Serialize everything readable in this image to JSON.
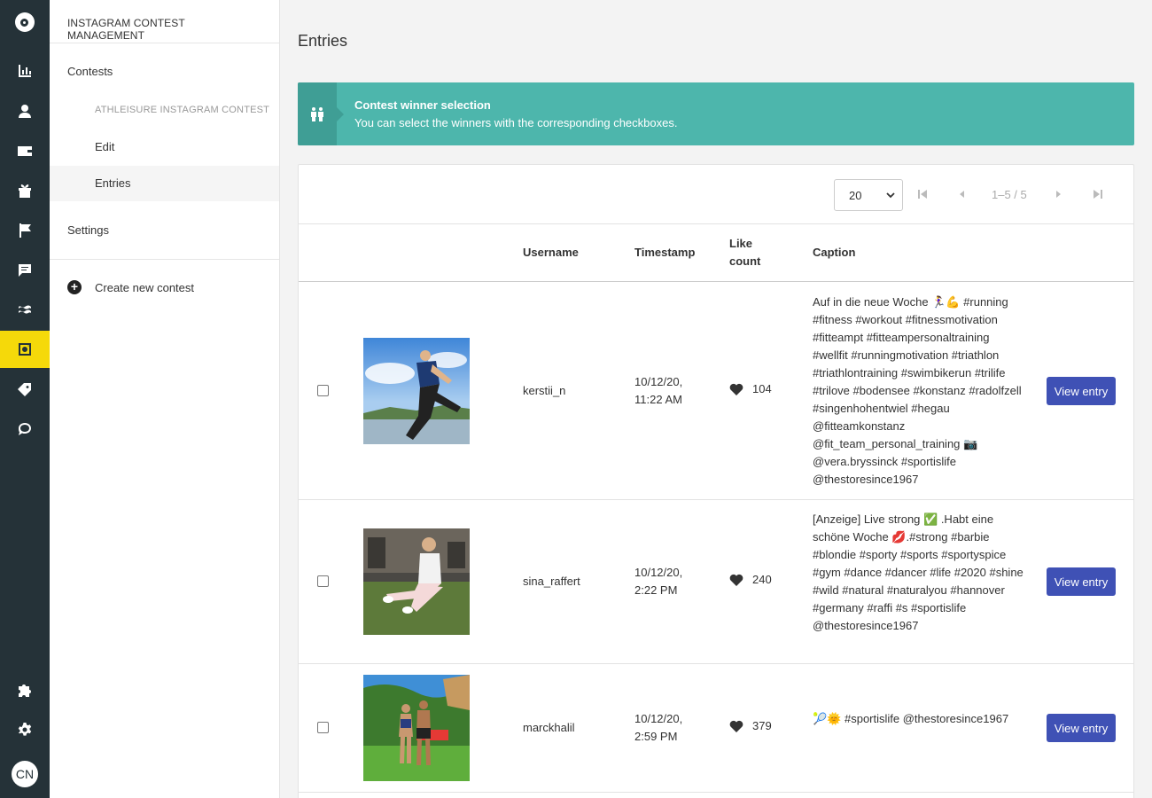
{
  "app": {
    "avatar_initials": "CN"
  },
  "subnav": {
    "header": "INSTAGRAM CONTEST MANAGEMENT",
    "contests": "Contests",
    "contest_name": "ATHLEISURE INSTAGRAM CONTEST",
    "edit": "Edit",
    "entries": "Entries",
    "settings": "Settings",
    "create": "Create new contest"
  },
  "main": {
    "title": "Entries",
    "alert": {
      "title": "Contest winner selection",
      "text": "You can select the winners with the corresponding checkboxes."
    },
    "pager": {
      "page_size": "20",
      "range": "1–5 / 5"
    },
    "columns": {
      "username": "Username",
      "timestamp": "Timestamp",
      "like_count_1": "Like",
      "like_count_2": "count",
      "caption": "Caption"
    },
    "view_label": "View entry",
    "rows": [
      {
        "username": "kerstii_n",
        "date": "10/12/20,",
        "time": "11:22 AM",
        "likes": "104",
        "caption": "Auf in die neue Woche 🏃‍♀️💪 #running #fitness #workout #fitnessmotivation #fitteampt #fitteampersonaltraining #wellfit #runningmotivation #triathlon #triathlontraining #swimbikerun #trilife #trilove #bodensee #konstanz #radolfzell #singenhohentwiel #hegau @fitteamkonstanz @fit_team_personal_training 📷 @vera.bryssinck #sportislife @thestoresince1967"
      },
      {
        "username": "sina_raffert",
        "date": "10/12/20,",
        "time": "2:22 PM",
        "likes": "240",
        "caption": "[Anzeige] Live strong ✅ .Habt eine schöne Woche 💋.#strong #barbie #blondie #sporty #sports #sportyspice #gym #dance #dancer #life #2020 #shine #wild #natural #naturalyou #hannover #germany #raffi #s #sportislife @thestoresince1967"
      },
      {
        "username": "marckhalil",
        "date": "10/12/20,",
        "time": "2:59 PM",
        "likes": "379",
        "caption": "🎾🌞 #sportislife @thestoresince1967"
      }
    ]
  },
  "colors": {
    "rail": "#253238",
    "accent": "#f5d90a",
    "alert": "#4db6ac",
    "button": "#3f51b5"
  }
}
